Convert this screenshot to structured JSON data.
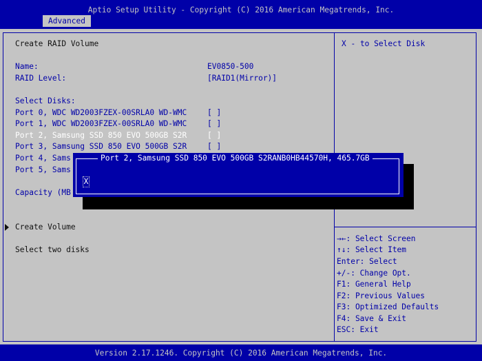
{
  "window": {
    "title": "Aptio Setup Utility - Copyright (C) 2016 American Megatrends, Inc.",
    "active_tab": "Advanced"
  },
  "main": {
    "heading": "Create RAID Volume",
    "name_label": "Name:",
    "name_value": "EV0850-500",
    "raid_label": "RAID Level:",
    "raid_value": "[RAID1(Mirror)]",
    "select_disks_label": "Select Disks:",
    "ports": [
      {
        "label": "Port 0, WDC WD2003FZEX-00SRLA0 WD-WMC",
        "value": "[ ]"
      },
      {
        "label": "Port 1, WDC WD2003FZEX-00SRLA0 WD-WMC",
        "value": "[ ]"
      },
      {
        "label": "Port 2, Samsung SSD 850 EVO 500GB S2R",
        "value": "[ ]"
      },
      {
        "label": "Port 3, Samsung SSD 850 EVO 500GB S2R",
        "value": "[ ]"
      },
      {
        "label": "Port 4, Sams",
        "value": ""
      },
      {
        "label": "Port 5, Sams",
        "value": ""
      }
    ],
    "capacity_label": "Capacity (MB",
    "create_volume": "Create Volume",
    "hint": "Select two disks"
  },
  "help": {
    "top": "X - to Select Disk",
    "keys": [
      "→←: Select Screen",
      "↑↓: Select Item",
      "Enter: Select",
      "+/-: Change Opt.",
      "F1: General Help",
      "F2: Previous Values",
      "F3: Optimized Defaults",
      "F4: Save & Exit",
      "ESC: Exit"
    ]
  },
  "popup": {
    "title": "Port 2, Samsung SSD 850 EVO 500GB S2RANB0HB44570H, 465.7GB",
    "input_value": "X"
  },
  "footer": {
    "version": "Version 2.17.1246. Copyright (C) 2016 American Megatrends, Inc."
  },
  "colors": {
    "bios_blue": "#0000a8",
    "background_gray": "#c4c4c4",
    "highlight_white": "#ffffff"
  }
}
